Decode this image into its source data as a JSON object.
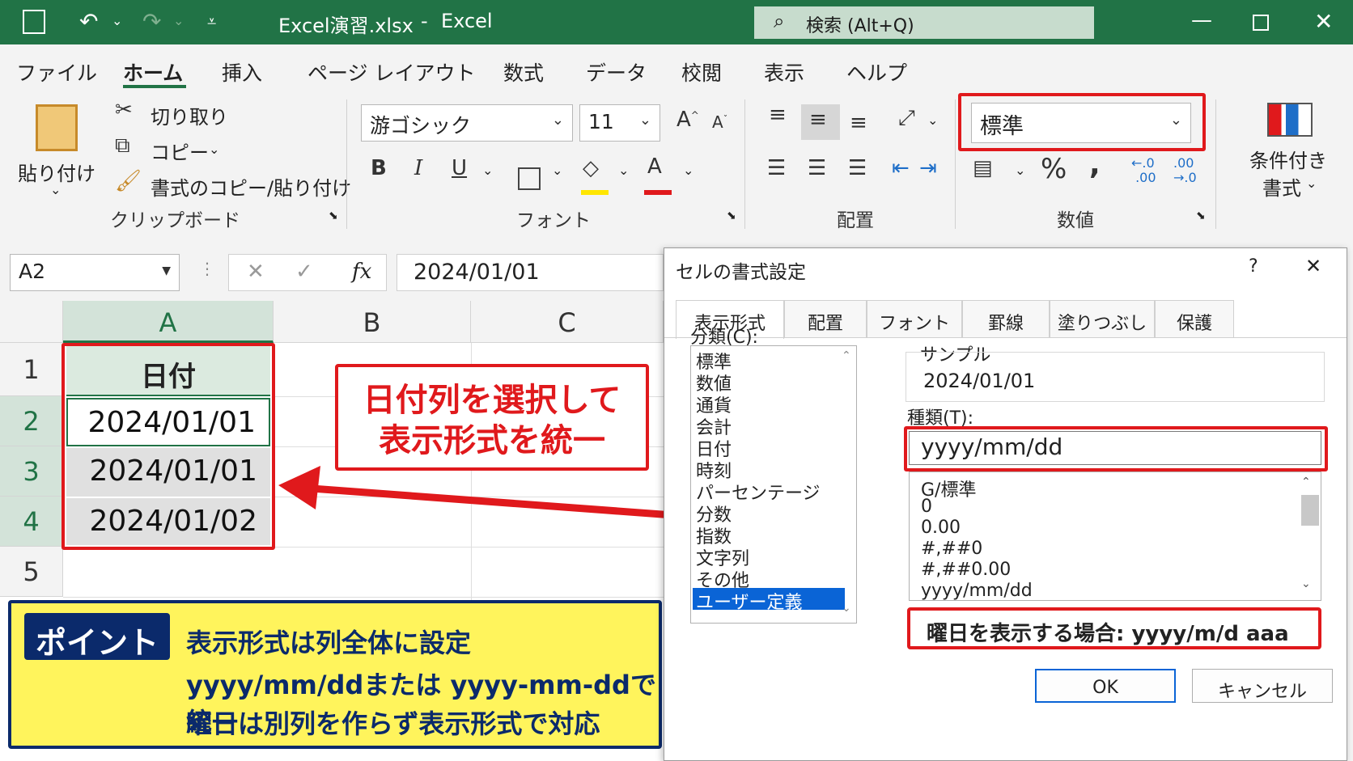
{
  "titlebar": {
    "filename": "Excel演習.xlsx",
    "separator": "-",
    "app": "Excel",
    "search": "検索 (Alt+Q)"
  },
  "tabs": [
    "ファイル",
    "ホーム",
    "挿入",
    "ページ レイアウト",
    "数式",
    "データ",
    "校閲",
    "表示",
    "ヘルプ"
  ],
  "ribbon": {
    "paste": "貼り付け",
    "cut": "切り取り",
    "copy": "コピー",
    "format_painter": "書式のコピー/貼り付け",
    "clipboard_group": "クリップボード",
    "font_name": "游ゴシック",
    "font_size": "11",
    "font_group": "フォント",
    "bold": "B",
    "italic": "I",
    "underline": "U",
    "alignment_group": "配置",
    "number_format": "標準",
    "number_group": "数値",
    "percent": "%",
    "comma": ",",
    "conditional_format_1": "条件付き",
    "conditional_format_2": "書式"
  },
  "formula_bar": {
    "name_box": "A2",
    "fx": "fx",
    "value": "2024/01/01"
  },
  "sheet": {
    "columns": [
      "A",
      "B",
      "C"
    ],
    "rows": [
      "1",
      "2",
      "3",
      "4",
      "5"
    ],
    "header_cell": "日付",
    "cells": [
      "2024/01/01",
      "2024/01/01",
      "2024/01/02"
    ]
  },
  "callout": {
    "line1": "日付列を選択して",
    "line2": "表示形式を統一"
  },
  "point": {
    "badge": "ポイント",
    "line1": "表示形式は列全体に設定",
    "line2": "yyyy/mm/ddまたは yyyy-mm-ddで統一",
    "line3": "曜日は別列を作らず表示形式で対応"
  },
  "dialog": {
    "title": "セルの書式設定",
    "help": "?",
    "close": "✕",
    "tabs": [
      "表示形式",
      "配置",
      "フォント",
      "罫線",
      "塗りつぶし",
      "保護"
    ],
    "category_label": "分類(C):",
    "categories": [
      "標準",
      "数値",
      "通貨",
      "会計",
      "日付",
      "時刻",
      "パーセンテージ",
      "分数",
      "指数",
      "文字列",
      "その他",
      "ユーザー定義"
    ],
    "sample_label": "サンプル",
    "sample_value": "2024/01/01",
    "type_label": "種類(T):",
    "type_value": "yyyy/mm/dd",
    "formats": [
      "G/標準",
      "0",
      "0.00",
      "#,##0",
      "#,##0.00",
      "yyyy/mm/dd"
    ],
    "weekday_note": "曜日を表示する場合: yyyy/m/d aaa",
    "ok": "OK",
    "cancel": "キャンセル"
  },
  "colors": {
    "excel_green": "#217346",
    "highlight_red": "#e0191c",
    "point_yellow": "#fff45c",
    "point_navy": "#0b2a6b",
    "selection_blue": "#0a64d6"
  }
}
